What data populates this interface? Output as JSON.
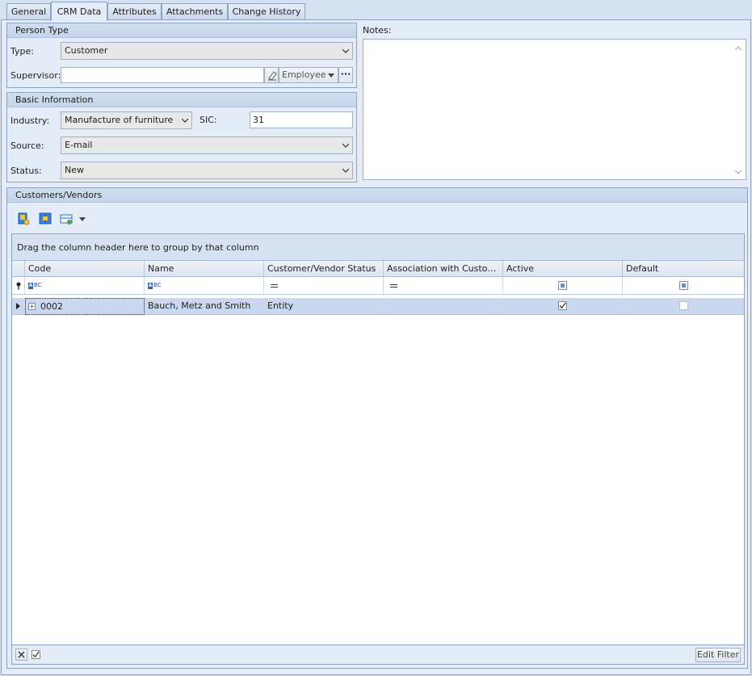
{
  "tabs": [
    {
      "label": "General"
    },
    {
      "label": "CRM Data"
    },
    {
      "label": "Attributes"
    },
    {
      "label": "Attachments"
    },
    {
      "label": "Change History"
    }
  ],
  "person_type": {
    "header": "Person Type",
    "type_label": "Type:",
    "type_value": "Customer",
    "supervisor_label": "Supervisor:",
    "supervisor_value": "",
    "supervisor_kind": "Employee",
    "more_label": "···"
  },
  "basic_info": {
    "header": "Basic Information",
    "industry_label": "Industry:",
    "industry_value": "Manufacture of furniture",
    "sic_label": "SIC:",
    "sic_value": "31",
    "source_label": "Source:",
    "source_value": "E-mail",
    "status_label": "Status:",
    "status_value": "New"
  },
  "notes": {
    "label": "Notes:",
    "value": ""
  },
  "customers_vendors": {
    "header": "Customers/Vendors",
    "group_hint": "Drag the column header here to group by that column",
    "columns": [
      "Code",
      "Name",
      "Customer/Vendor Status",
      "Association with Custom...",
      "Active",
      "Default"
    ],
    "rows": [
      {
        "code": "0002",
        "name": "Bauch, Metz and Smith",
        "status": "Entity",
        "association": "",
        "active": true,
        "default": false
      }
    ],
    "edit_filter_label": "Edit Filter"
  },
  "colors": {
    "background": "#d6e2f2",
    "selected_row": "#c9d8ee",
    "border": "#8ea3c4"
  }
}
